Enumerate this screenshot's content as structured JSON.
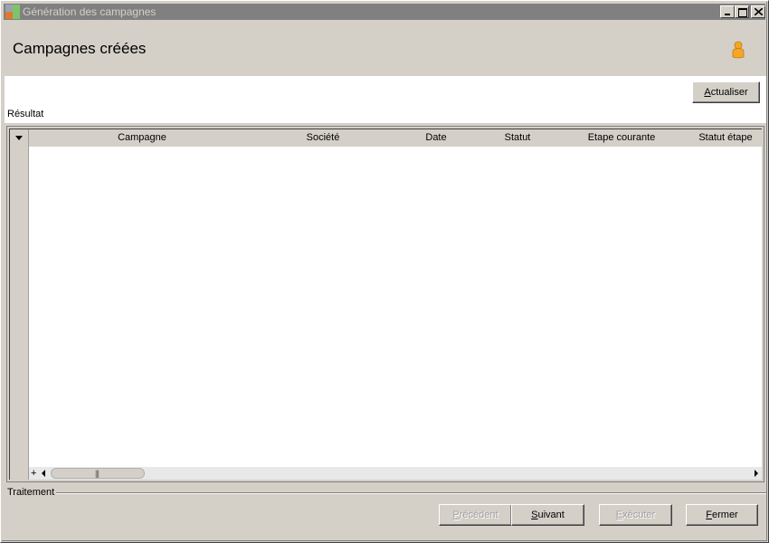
{
  "window": {
    "title": "Génération des campagnes"
  },
  "header": {
    "title": "Campagnes créées"
  },
  "toolbar": {
    "refresh_label": "Actualiser"
  },
  "result": {
    "label": "Résultat",
    "columns": [
      "Campagne",
      "Société",
      "Date",
      "Statut",
      "Etape courante",
      "Statut étape"
    ],
    "rows": [],
    "expand_symbol": "+",
    "scroll_grip": "|||"
  },
  "processing": {
    "label": "Traitement"
  },
  "footer": {
    "previous_label": "Précédent",
    "next_label": "Suivant",
    "execute_label": "Exécuter",
    "close_label": "Fermer"
  }
}
